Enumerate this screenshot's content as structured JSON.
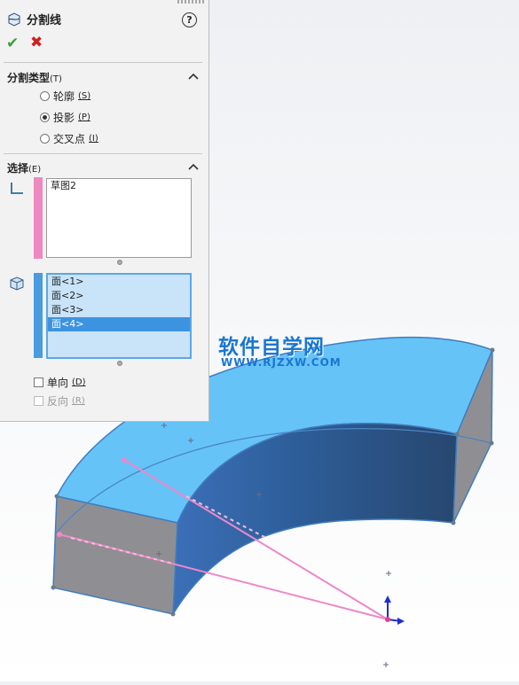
{
  "panel": {
    "title": "分割线",
    "help_symbol": "?",
    "ok_symbol": "✔",
    "cancel_symbol": "✖",
    "split_type": {
      "heading": "分割类型",
      "heading_key": "(T)",
      "options": [
        {
          "label": "轮廓",
          "key": "(S)",
          "selected": false
        },
        {
          "label": "投影",
          "key": "(P)",
          "selected": true
        },
        {
          "label": "交叉点",
          "key": "(I)",
          "selected": false
        }
      ]
    },
    "selection": {
      "heading": "选择",
      "heading_key": "(E)",
      "sketch_items": [
        "草图2"
      ],
      "face_items": [
        "面<1>",
        "面<2>",
        "面<3>",
        "面<4>"
      ],
      "selected_face": "面<4>",
      "single_direction": {
        "label": "单向",
        "key": "(D)",
        "checked": false
      },
      "reverse_direction": {
        "label": "反向",
        "key": "(R)",
        "checked": false,
        "enabled": false
      }
    }
  },
  "watermark": {
    "line1": "软件自学网",
    "line2": "WWW.RJZXW.COM"
  },
  "colors": {
    "face_top": "#66c3f8",
    "face_inner": "#2f5f9a",
    "face_end": "#8f8f93",
    "edge": "#3f7dc0",
    "sketch_line": "#ee88c8",
    "sketch_bar": "#ef88c0",
    "face_bar": "#4a9be0",
    "selection_highlight": "#3c93e0",
    "watermark": "#1a76d2"
  }
}
